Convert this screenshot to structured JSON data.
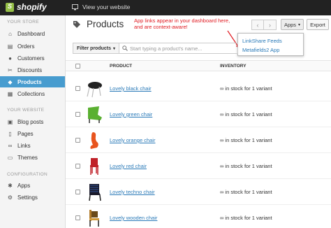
{
  "topbar": {
    "logo": "shopify",
    "view_site": "View your website"
  },
  "sidebar": {
    "section_store": "YOUR STORE",
    "section_website": "YOUR WEBSITE",
    "section_config": "CONFIGURATION",
    "items": [
      {
        "label": "Dashboard",
        "icon": "home-icon"
      },
      {
        "label": "Orders",
        "icon": "inbox-icon"
      },
      {
        "label": "Customers",
        "icon": "user-icon"
      },
      {
        "label": "Discounts",
        "icon": "ticket-icon"
      },
      {
        "label": "Products",
        "icon": "tag-icon"
      },
      {
        "label": "Collections",
        "icon": "collection-icon"
      },
      {
        "label": "Blog posts",
        "icon": "blog-icon"
      },
      {
        "label": "Pages",
        "icon": "page-icon"
      },
      {
        "label": "Links",
        "icon": "link-icon"
      },
      {
        "label": "Themes",
        "icon": "theme-icon"
      },
      {
        "label": "Apps",
        "icon": "apps-icon"
      },
      {
        "label": "Settings",
        "icon": "gear-icon"
      }
    ],
    "active": "Products"
  },
  "header": {
    "title": "Products",
    "annotation": "App links appear in your dashboard here, and are context-aware!",
    "apps_label": "Apps",
    "export_label": "Export"
  },
  "apps_menu": {
    "items": [
      "LinkShare Feeds",
      "Metafields2 App"
    ]
  },
  "filter": {
    "button_label": "Filter products",
    "search_placeholder": "Start typing a product's name..."
  },
  "table": {
    "columns": [
      "PRODUCT",
      "INVENTORY"
    ],
    "rows": [
      {
        "name": "Lovely black chair",
        "inventory": "∞ in stock for 1 variant"
      },
      {
        "name": "Lovely green chair",
        "inventory": "∞ in stock for 1 variant"
      },
      {
        "name": "Lovely orange chair",
        "inventory": "∞ in stock for 1 variant"
      },
      {
        "name": "Lovely red chair",
        "inventory": "∞ in stock for 1 variant"
      },
      {
        "name": "Lovely techno chair",
        "inventory": "∞ in stock for 1 variant"
      },
      {
        "name": "Lovely wooden chair",
        "inventory": "∞ in stock for 1 variant"
      }
    ]
  },
  "colors": {
    "accent": "#479ccf",
    "link": "#2a7ab8",
    "annotation": "#e01b22",
    "brand": "#95bf47"
  }
}
